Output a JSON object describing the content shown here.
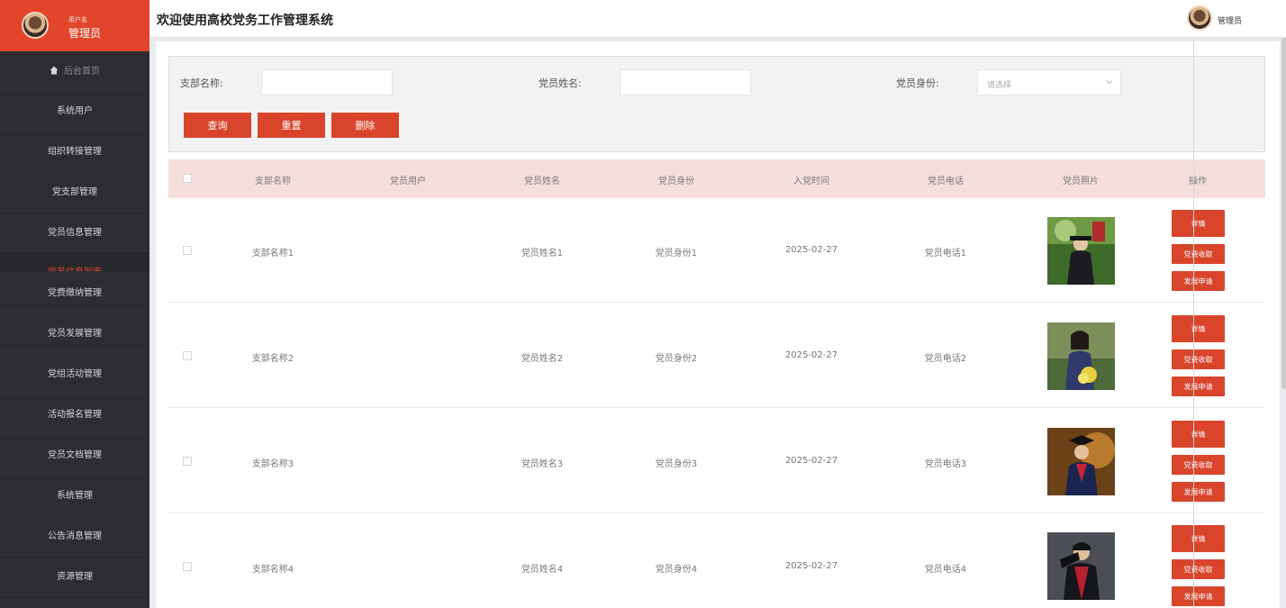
{
  "sidebar": {
    "user_small": "用户名",
    "user_role": "管理员",
    "home": "后台首页",
    "items": [
      "系统用户",
      "组织转接管理",
      "党支部管理",
      "党员信息管理",
      "党员信息列表",
      "党费缴纳管理",
      "党员发展管理",
      "党组活动管理",
      "活动报名管理",
      "党员文档管理",
      "系统管理",
      "公告消息管理",
      "资源管理"
    ]
  },
  "header": {
    "title": "欢迎使用高校党务工作管理系统",
    "user": "管理员"
  },
  "search": {
    "branch_label": "支部名称:",
    "name_label": "党员姓名:",
    "identity_label": "党员身份:",
    "identity_placeholder": "请选择",
    "buttons": {
      "query": "查询",
      "reset": "重置",
      "delete": "删除"
    }
  },
  "table": {
    "columns": [
      "支部名称",
      "党员用户",
      "党员姓名",
      "党员身份",
      "入党时间",
      "党员电话",
      "党员照片",
      "操作"
    ],
    "rows": [
      {
        "branch": "支部名称1",
        "user": "",
        "name": "党员姓名1",
        "identity": "党员身份1",
        "date": "2025-02-27",
        "phone": "党员电话1"
      },
      {
        "branch": "支部名称2",
        "user": "",
        "name": "党员姓名2",
        "identity": "党员身份2",
        "date": "2025-02-27",
        "phone": "党员电话2"
      },
      {
        "branch": "支部名称3",
        "user": "",
        "name": "党员姓名3",
        "identity": "党员身份3",
        "date": "2025-02-27",
        "phone": "党员电话3"
      },
      {
        "branch": "支部名称4",
        "user": "",
        "name": "党员姓名4",
        "identity": "党员身份4",
        "date": "2025-02-27",
        "phone": "党员电话4"
      }
    ],
    "actions": {
      "detail": "详情",
      "fee": "党费收取",
      "apply": "发展申请"
    }
  },
  "colors": {
    "accent": "#d9452b",
    "sidebar_bg": "#2b2d31",
    "header_row": "#f6dedd"
  }
}
